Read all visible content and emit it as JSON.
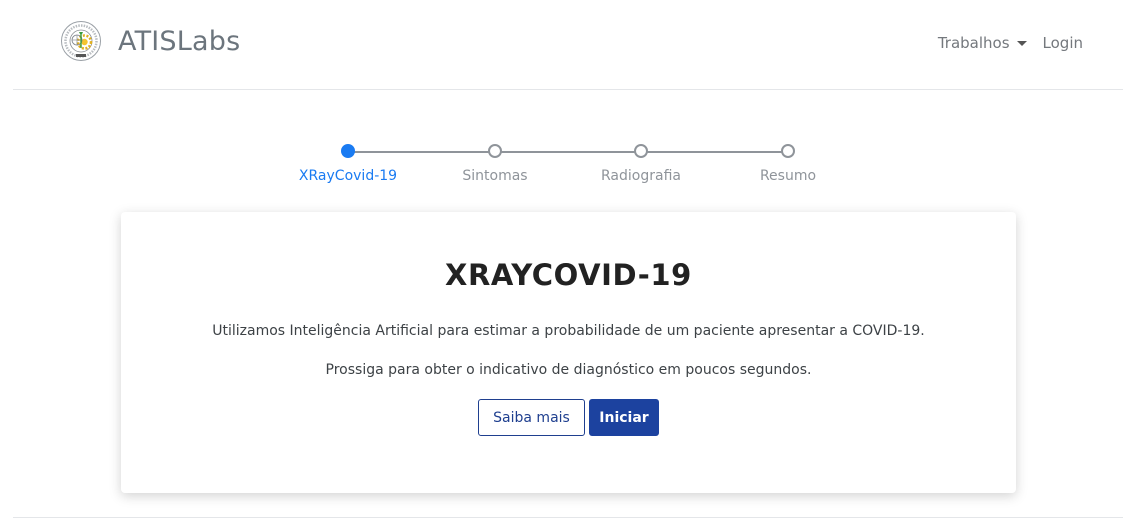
{
  "navbar": {
    "brand": "ATISLabs",
    "logo_icon": "university-seal-icon",
    "links": [
      {
        "label": "Trabalhos",
        "has_dropdown": true
      },
      {
        "label": "Login",
        "has_dropdown": false
      }
    ]
  },
  "stepper": {
    "active_color": "#1a7bf2",
    "steps": [
      {
        "label": "XRayCovid-19",
        "active": true
      },
      {
        "label": "Sintomas",
        "active": false
      },
      {
        "label": "Radiografia",
        "active": false
      },
      {
        "label": "Resumo",
        "active": false
      }
    ]
  },
  "card": {
    "title": "XRAYCOVID-19",
    "text_1": "Utilizamos Inteligência Artificial para estimar a probabilidade de um paciente apresentar a COVID-19.",
    "text_2": "Prossiga para obter o indicativo de diagnóstico em poucos segundos.",
    "secondary_button": "Saiba mais",
    "primary_button": "Iniciar",
    "primary_color": "#1c429f"
  }
}
